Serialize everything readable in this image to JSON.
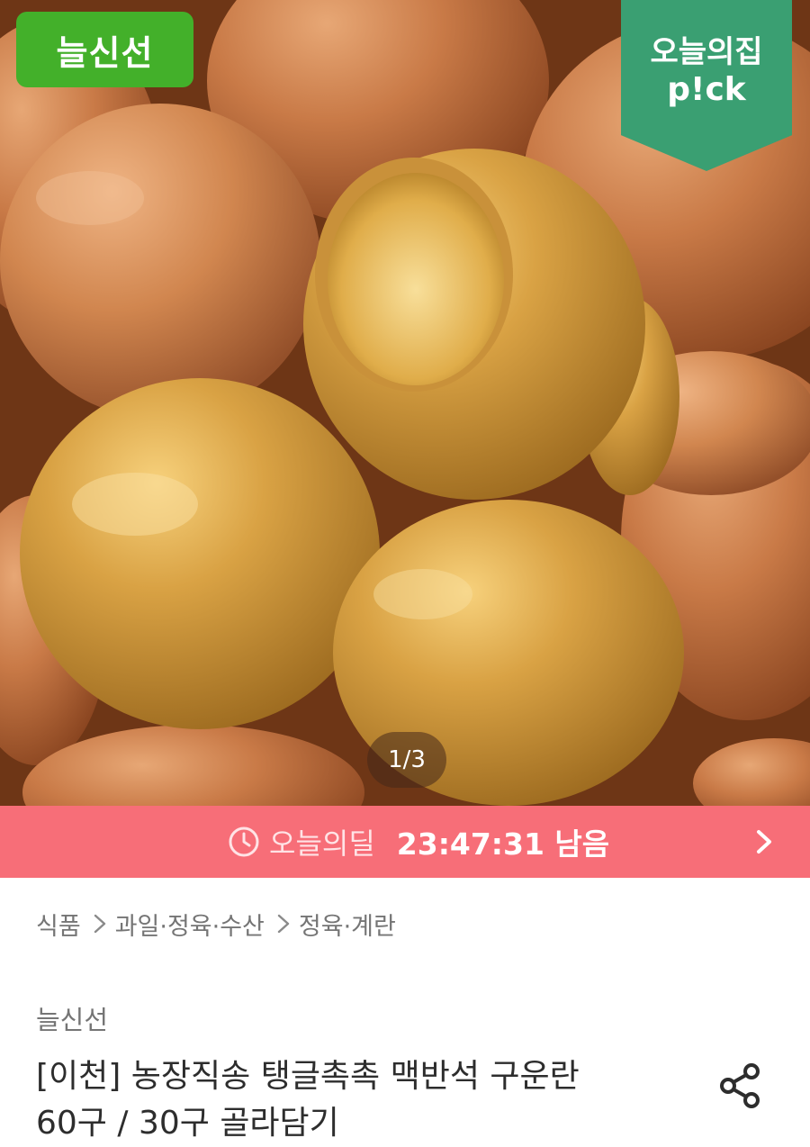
{
  "hero": {
    "brand_badge": "늘신선",
    "pick_badge": {
      "line1": "오늘의집",
      "line2": "p!ck"
    },
    "pager": "1/3",
    "image_icon": "boiled-eggs-photo"
  },
  "deal": {
    "icon": "clock-icon",
    "label": "오늘의딜",
    "timer": "23:47:31 남음",
    "arrow_icon": "chevron-right-icon",
    "bar_color": "#f76e78"
  },
  "breadcrumb": {
    "items": [
      "식품",
      "과일·정육·수산",
      "정육·계란"
    ],
    "separator_icon": "chevron-right-icon"
  },
  "product": {
    "seller": "늘신선",
    "title_line1": "[이천] 농장직송 탱글촉촉 맥반석 구운란",
    "title_line2": "60구 / 30구 골라담기",
    "share_icon": "share-icon"
  },
  "colors": {
    "brand_badge": "#43b02a",
    "pick_badge": "#3a9f72",
    "deal_bar": "#f76e78"
  }
}
